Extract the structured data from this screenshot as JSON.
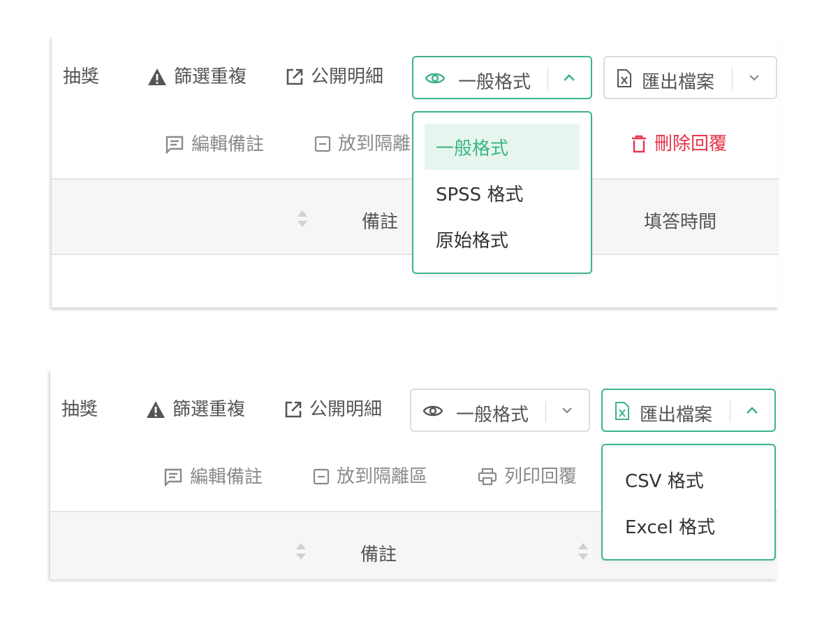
{
  "panel1": {
    "toolbar": {
      "lottery_label": "抽獎",
      "filter_duplicates_label": "篩選重複",
      "public_details_label": "公開明細",
      "view_format_select": {
        "value": "一般格式",
        "expanded": true
      },
      "export_select": {
        "value": "匯出檔案",
        "expanded": false
      }
    },
    "actions": {
      "edit_notes_label": "編輯備註",
      "quarantine_label": "放到隔離",
      "delete_replies_label": "刪除回覆"
    },
    "table_header": {
      "notes_label": "備註",
      "answer_time_label": "填答時間"
    },
    "view_format_dropdown": {
      "options": [
        "一般格式",
        "SPSS 格式",
        "原始格式"
      ],
      "selected": "一般格式"
    }
  },
  "panel2": {
    "toolbar": {
      "lottery_label": "抽獎",
      "filter_duplicates_label": "篩選重複",
      "public_details_label": "公開明細",
      "view_format_select": {
        "value": "一般格式",
        "expanded": false
      },
      "export_select": {
        "value": "匯出檔案",
        "expanded": true
      }
    },
    "actions": {
      "edit_notes_label": "編輯備註",
      "quarantine_label": "放到隔離區",
      "print_replies_label": "列印回覆"
    },
    "table_header": {
      "notes_label": "備註"
    },
    "export_dropdown": {
      "options": [
        "CSV 格式",
        "Excel 格式"
      ]
    }
  },
  "colors": {
    "accent": "#3cb486",
    "accent_bg": "#e6f6ef",
    "danger": "#e8334a",
    "text": "#555555",
    "muted": "#8a8a8a",
    "border": "#dcdcdc",
    "header_bg": "#f6f6f6"
  },
  "icons": [
    "warning-icon",
    "external-link-icon",
    "eye-icon",
    "chevron-up-icon",
    "chevron-down-icon",
    "excel-file-icon",
    "note-icon",
    "minus-square-icon",
    "printer-icon",
    "trash-icon",
    "sort-icon"
  ]
}
